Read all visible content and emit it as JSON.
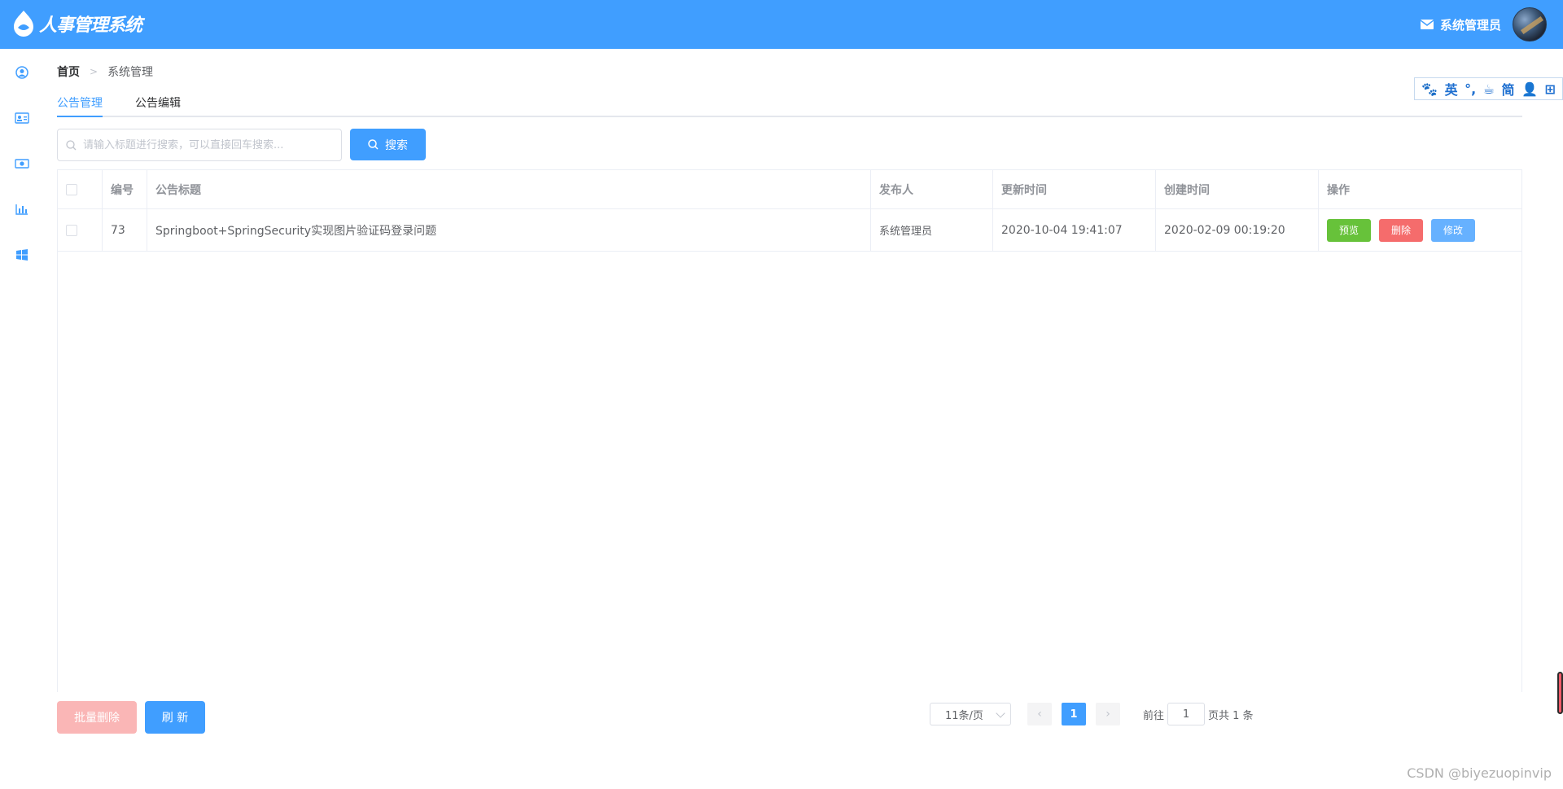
{
  "header": {
    "logo_text": "人事管理系统",
    "username": "系统管理员"
  },
  "sidebar": {
    "items": [
      {
        "icon": "user-circle-icon"
      },
      {
        "icon": "id-card-icon"
      },
      {
        "icon": "money-icon"
      },
      {
        "icon": "bar-chart-icon"
      },
      {
        "icon": "windows-icon"
      }
    ]
  },
  "ime": {
    "paw": "🐾",
    "lang": "英",
    "punct": "°,",
    "cup": "☕",
    "simp": "简",
    "person": "👤",
    "grid": "⊞"
  },
  "breadcrumb": {
    "home": "首页",
    "current": "系统管理"
  },
  "tabs": [
    {
      "label": "公告管理",
      "active": true
    },
    {
      "label": "公告编辑",
      "active": false
    }
  ],
  "search": {
    "placeholder": "请输入标题进行搜索，可以直接回车搜索...",
    "value": "",
    "button_label": "搜索"
  },
  "table": {
    "columns": [
      "编号",
      "公告标题",
      "发布人",
      "更新时间",
      "创建时间",
      "操作"
    ],
    "rows": [
      {
        "id": "73",
        "title": "Springboot+SpringSecurity实现图片验证码登录问题",
        "publisher": "系统管理员",
        "updated": "2020-10-04 19:41:07",
        "created": "2020-02-09 00:19:20",
        "actions": {
          "preview": "预览",
          "delete": "删除",
          "edit": "修改"
        }
      }
    ]
  },
  "footer": {
    "batch_delete": "批量删除",
    "refresh": "刷 新"
  },
  "pagination": {
    "page_size": "11条/页",
    "current_page": "1",
    "goto_label": "前往",
    "goto_value": "1",
    "total_text": "页共 1 条"
  },
  "watermark": "CSDN @biyezuopinvip",
  "colors": {
    "primary": "#409eff",
    "success": "#67c23a",
    "danger": "#f56c6c",
    "danger_light": "#fab6b6",
    "info_light": "#66b1ff"
  }
}
